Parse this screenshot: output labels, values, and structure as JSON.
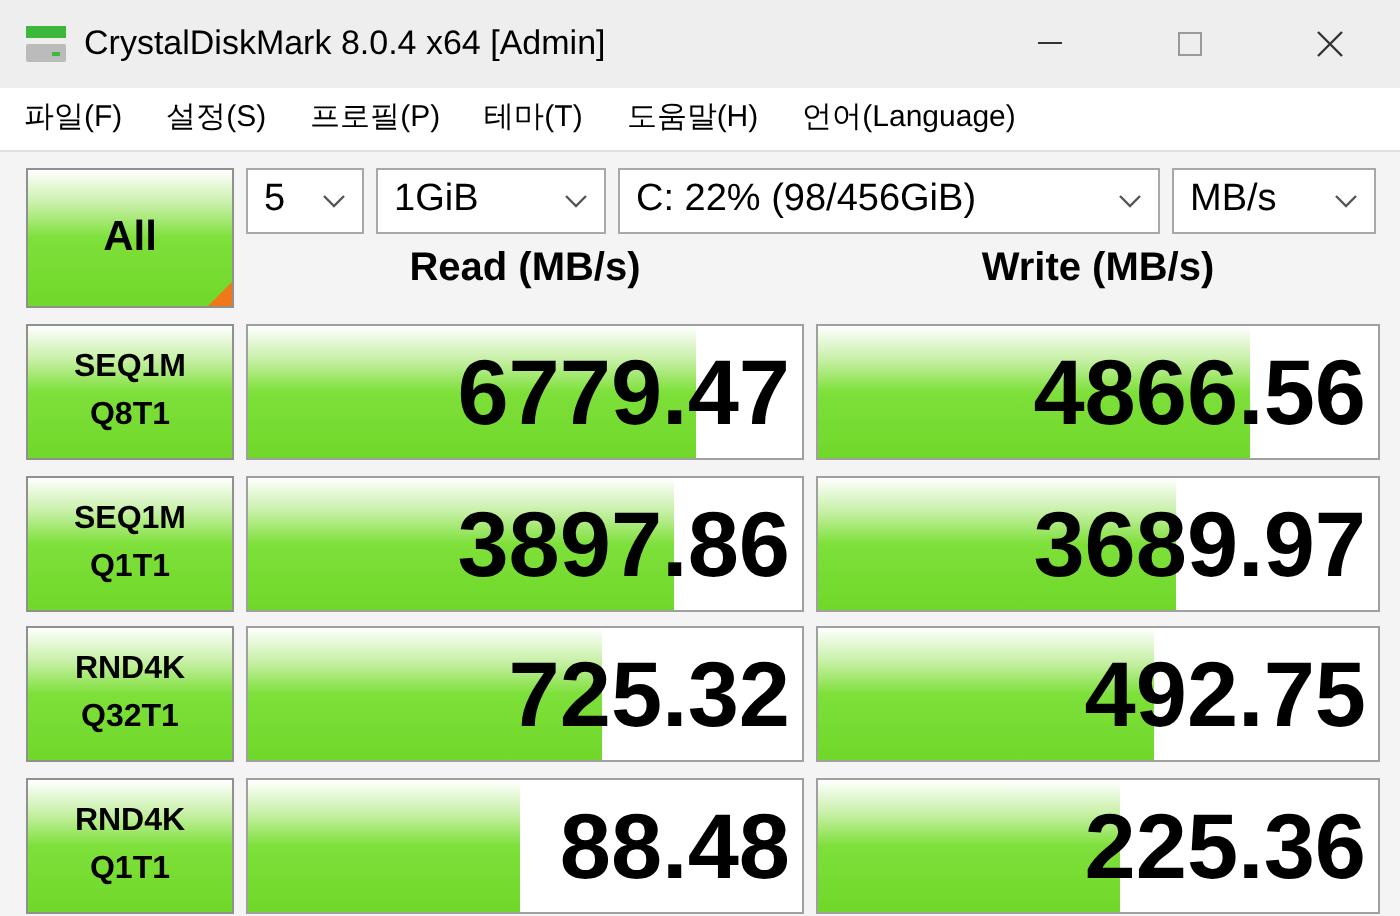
{
  "window": {
    "title": "CrystalDiskMark 8.0.4 x64 [Admin]"
  },
  "menu": [
    "파일(F)",
    "설정(S)",
    "프로필(P)",
    "테마(T)",
    "도움말(H)",
    "언어(Language)"
  ],
  "all_button": {
    "label": "All"
  },
  "selectors": [
    {
      "value": "5"
    },
    {
      "value": "1GiB"
    },
    {
      "value": "C: 22% (98/456GiB)"
    },
    {
      "value": "MB/s"
    }
  ],
  "columns": [
    "Read (MB/s)",
    "Write (MB/s)"
  ],
  "tests": [
    {
      "line1": "SEQ1M",
      "line2": "Q8T1",
      "read": {
        "value": "6779.47",
        "level": 0.81
      },
      "write": {
        "value": "4866.56",
        "level": 0.77
      }
    },
    {
      "line1": "SEQ1M",
      "line2": "Q1T1",
      "read": {
        "value": "3897.86",
        "level": 0.77
      },
      "write": {
        "value": "3689.97",
        "level": 0.64
      }
    },
    {
      "line1": "RND4K",
      "line2": "Q32T1",
      "read": {
        "value": "725.32",
        "level": 0.64
      },
      "write": {
        "value": "492.75",
        "level": 0.6
      }
    },
    {
      "line1": "RND4K",
      "line2": "Q1T1",
      "read": {
        "value": "88.48",
        "level": 0.49
      },
      "write": {
        "value": "225.36",
        "level": 0.54
      }
    }
  ]
}
